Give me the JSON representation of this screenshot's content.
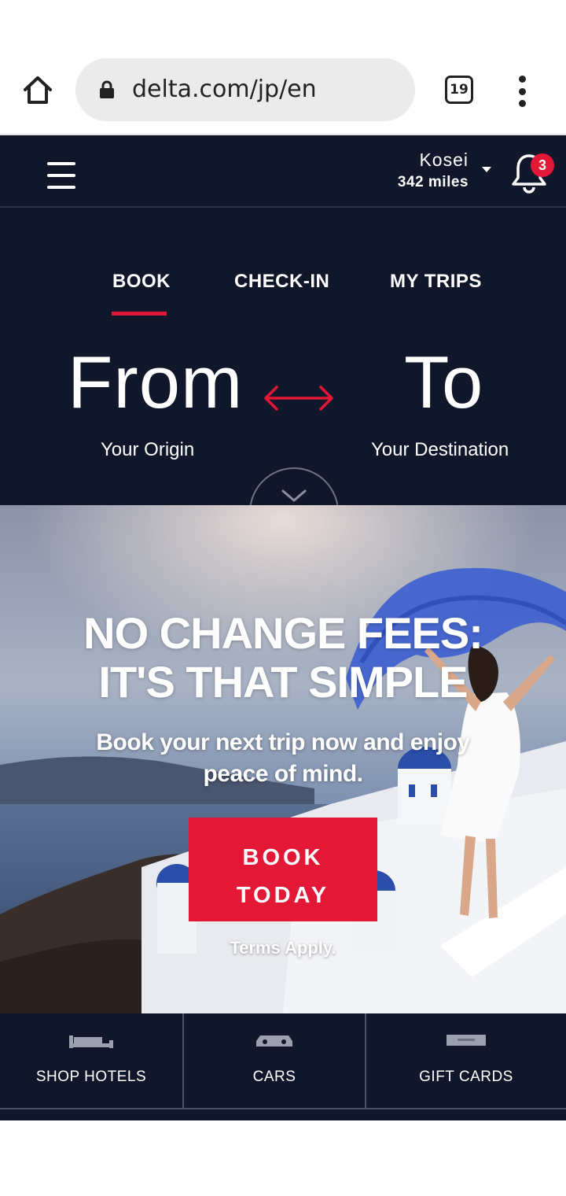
{
  "browser": {
    "url": "delta.com/jp/en",
    "tab_count": "19"
  },
  "header": {
    "user_name": "Kosei",
    "user_miles": "342 miles",
    "notification_count": "3"
  },
  "booking": {
    "tabs": [
      {
        "label": "BOOK",
        "active": true
      },
      {
        "label": "CHECK-IN",
        "active": false
      },
      {
        "label": "MY TRIPS",
        "active": false
      }
    ],
    "from_label": "From",
    "from_sub": "Your Origin",
    "to_label": "To",
    "to_sub": "Your Destination"
  },
  "hero": {
    "headline_line1": "NO CHANGE FEES:",
    "headline_line2": "IT'S THAT SIMPLE",
    "sub_line1": "Book your next trip now and enjoy",
    "sub_line2": "peace of mind.",
    "cta_line1": "BOOK",
    "cta_line2": "TODAY",
    "terms": "Terms Apply."
  },
  "shortcuts": [
    {
      "label": "SHOP HOTELS",
      "icon": "bed-icon"
    },
    {
      "label": "CARS",
      "icon": "car-icon"
    },
    {
      "label": "GIFT CARDS",
      "icon": "gift-card-icon"
    }
  ],
  "colors": {
    "navy": "#11172b",
    "accent_red": "#e31837"
  }
}
